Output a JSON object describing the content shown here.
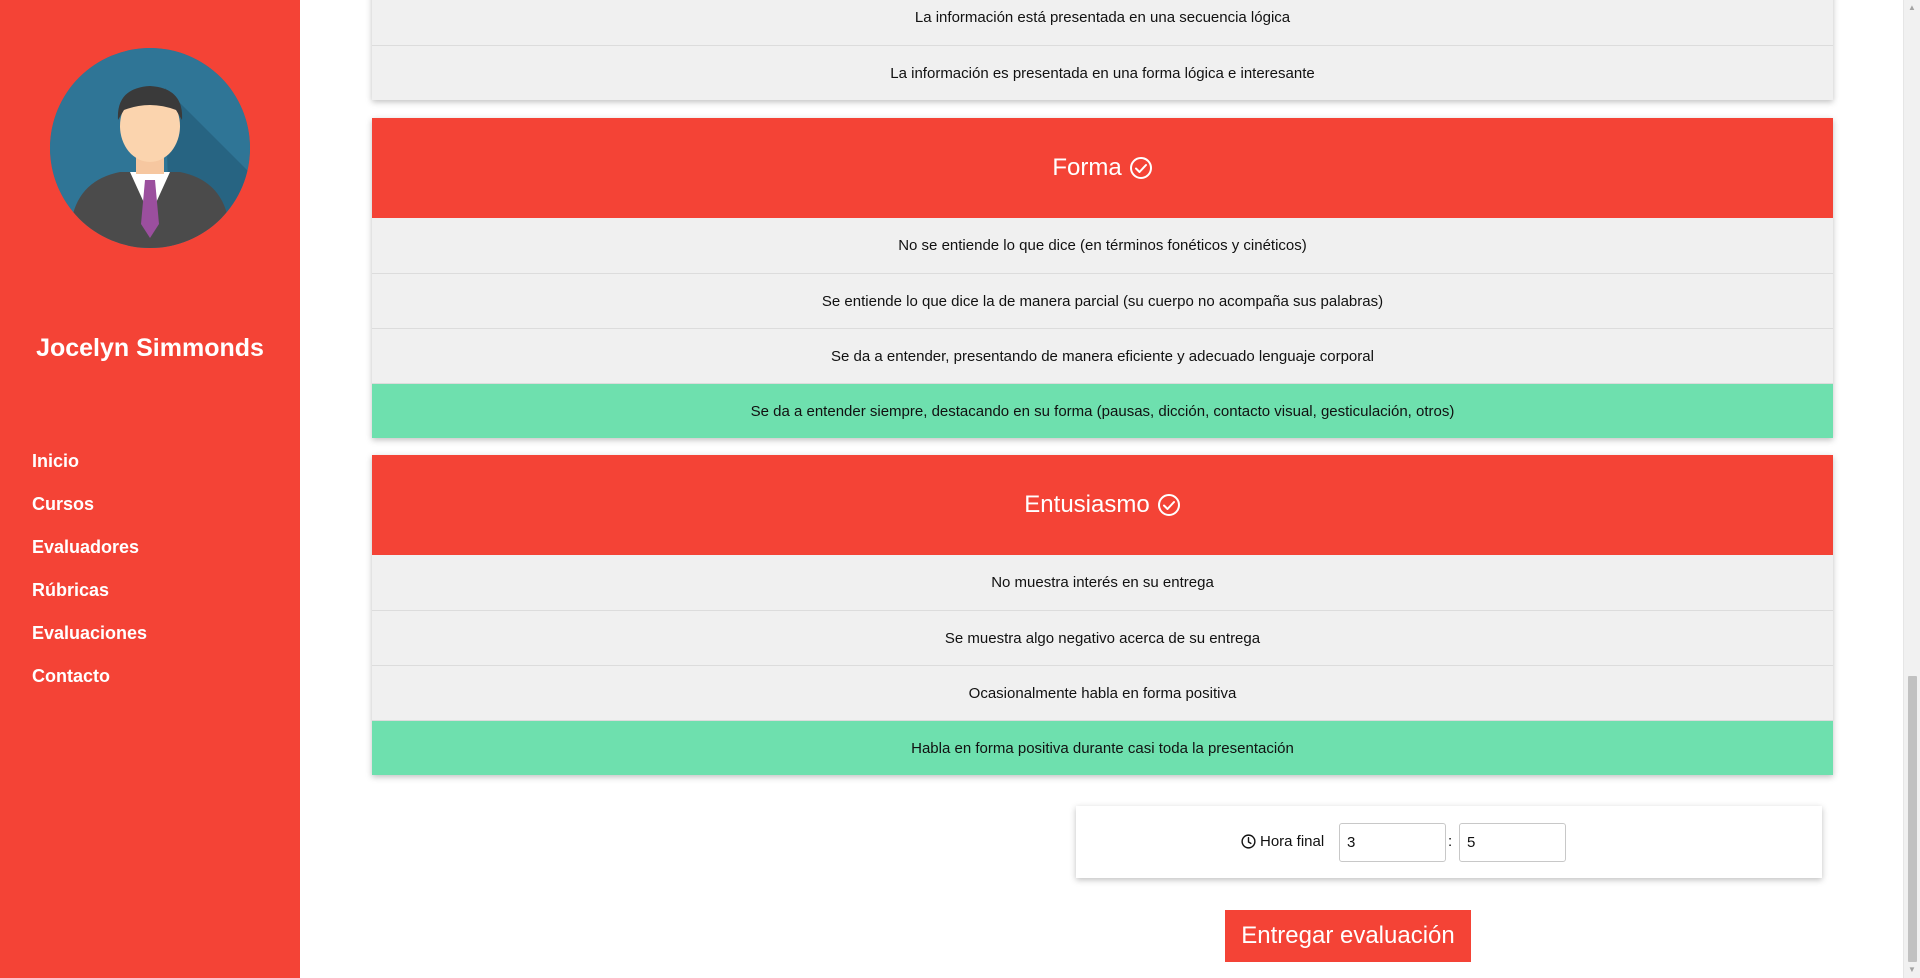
{
  "sidebar": {
    "user_name": "Jocelyn Simmonds",
    "nav": [
      "Inicio",
      "Cursos",
      "Evaluadores",
      "Rúbricas",
      "Evaluaciones",
      "Contacto"
    ]
  },
  "rubric_sections": [
    {
      "title": "",
      "options": [
        {
          "text": "La información está presentada en una secuencia lógica",
          "selected": false
        },
        {
          "text": "La información es presentada en una forma lógica e interesante",
          "selected": false
        }
      ]
    },
    {
      "title": "Forma",
      "icon": "check-circle-icon",
      "options": [
        {
          "text": "No se entiende lo que dice (en términos fonéticos y cinéticos)",
          "selected": false
        },
        {
          "text": "Se entiende lo que dice la de manera parcial (su cuerpo no acompaña sus palabras)",
          "selected": false
        },
        {
          "text": "Se da a entender, presentando de manera eficiente y adecuado lenguaje corporal",
          "selected": false
        },
        {
          "text": "Se da a entender siempre, destacando en su forma (pausas, dicción, contacto visual, gesticulación, otros)",
          "selected": true
        }
      ]
    },
    {
      "title": "Entusiasmo",
      "icon": "check-circle-icon",
      "options": [
        {
          "text": "No muestra interés en su entrega",
          "selected": false
        },
        {
          "text": "Se muestra algo negativo acerca de su entrega",
          "selected": false
        },
        {
          "text": "Ocasionalmente habla en forma positiva",
          "selected": false
        },
        {
          "text": "Habla en forma positiva durante casi toda la presentación",
          "selected": true
        }
      ]
    }
  ],
  "final_time": {
    "icon": "clock-icon",
    "label": "Hora final",
    "hours": "3",
    "separator": ":",
    "minutes": "5"
  },
  "submit_label": "Entregar evaluación",
  "colors": {
    "accent": "#f44336",
    "selected": "#6ee0ae",
    "option_bg": "#f0f0f0"
  }
}
